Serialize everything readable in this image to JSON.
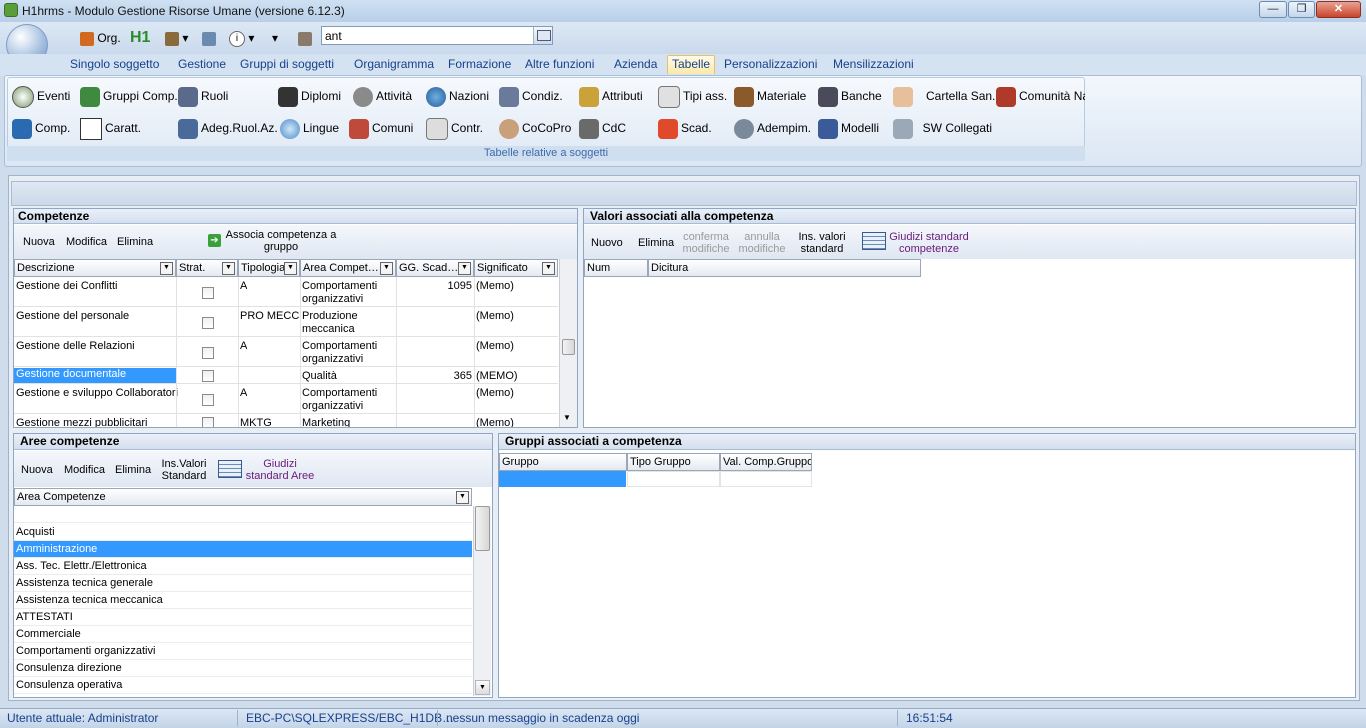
{
  "window": {
    "title": "H1hrms - Modulo Gestione Risorse Umane (versione 6.12.3)"
  },
  "qat": {
    "org_label": "Org.",
    "h1_label": "H1",
    "search_value": "ant"
  },
  "menu_tabs": [
    "Singolo soggetto",
    "Gestione",
    "Gruppi di soggetti",
    "Organigramma",
    "Formazione",
    "Altre funzioni",
    "Azienda",
    "Tabelle",
    "Personalizzazioni",
    "Mensilizzazioni"
  ],
  "ribbon": {
    "row1": [
      "Eventi",
      "Gruppi Comp.",
      "Ruoli",
      "Diplomi",
      "Attività",
      "Nazioni",
      "Condiz.",
      "Attributi",
      "Tipi ass.",
      "Materiale",
      "Banche",
      "Cartella San.",
      "Comunità Na"
    ],
    "row2": [
      "Comp.",
      "Caratt.",
      "Adeg.Ruol.Az.",
      "Lingue",
      "Comuni",
      "Contr.",
      "CoCoPro",
      "CdC",
      "Scad.",
      "Adempim.",
      "Modelli",
      "SW Collegati"
    ],
    "group_label": "Tabelle relative a soggetti"
  },
  "competenze": {
    "title": "Competenze",
    "toolbar": {
      "nuova": "Nuova",
      "modifica": "Modifica",
      "elimina": "Elimina",
      "associa_1": "Associa competenza a",
      "associa_2": "gruppo"
    },
    "columns": [
      "Descrizione",
      "Strat.",
      "Tipologia",
      "Area Compet…",
      "GG. Scad…",
      "Significato"
    ],
    "rows": [
      {
        "desc": "Gestione dei Conflitti",
        "tip": "A",
        "area1": "Comportamenti",
        "area2": "organizzativi",
        "gg": "1095",
        "sig": "(Memo)"
      },
      {
        "desc": "Gestione del personale",
        "tip": "PRO MECC",
        "area1": "Produzione",
        "area2": "meccanica",
        "gg": "",
        "sig": "(Memo)"
      },
      {
        "desc": "Gestione delle Relazioni",
        "tip": "A",
        "area1": "Comportamenti",
        "area2": "organizzativi",
        "gg": "",
        "sig": "(Memo)"
      },
      {
        "desc": "Gestione documentale",
        "tip": "",
        "area1": "Qualità",
        "area2": "",
        "gg": "365",
        "sig": "(MEMO)"
      },
      {
        "desc": "Gestione e sviluppo Collaboratori",
        "tip": "A",
        "area1": "Comportamenti",
        "area2": "organizzativi",
        "gg": "",
        "sig": "(Memo)"
      },
      {
        "desc": "Gestione mezzi pubblicitari",
        "tip": "MKTG",
        "area1": "Marketing",
        "area2": "",
        "gg": "",
        "sig": "(Memo)"
      }
    ]
  },
  "valori": {
    "title": "Valori associati alla competenza",
    "toolbar": {
      "nuovo": "Nuovo",
      "elimina": "Elimina",
      "conferma_1": "conferma",
      "conferma_2": "modifiche",
      "annulla_1": "annulla",
      "annulla_2": "modifiche",
      "ins_1": "Ins. valori",
      "ins_2": "standard",
      "giudizi_1": "Giudizi standard",
      "giudizi_2": "competenze"
    },
    "columns": [
      "Num",
      "Dicitura"
    ]
  },
  "aree": {
    "title": "Aree competenze",
    "toolbar": {
      "nuova": "Nuova",
      "modifica": "Modifica",
      "elimina": "Elimina",
      "ins_1": "Ins.Valori",
      "ins_2": "Standard",
      "giudizi_1": "Giudizi",
      "giudizi_2": "standard Aree"
    },
    "column": "Area Competenze",
    "items": [
      "",
      "Acquisti",
      "Amministrazione",
      "Ass. Tec. Elettr./Elettronica",
      "Assistenza tecnica generale",
      "Assistenza tecnica meccanica",
      "ATTESTATI",
      "Commerciale",
      "Comportamenti organizzativi",
      "Consulenza direzione",
      "Consulenza operativa"
    ]
  },
  "gruppi": {
    "title": "Gruppi associati a competenza",
    "columns": [
      "Gruppo",
      "Tipo Gruppo",
      "Val. Comp.Gruppo"
    ]
  },
  "status": {
    "user": "Utente attuale: Administrator",
    "db": "EBC-PC\\SQLEXPRESS/EBC_H1DB…",
    "messages": "nessun messaggio in scadenza oggi",
    "time": "16:51:54"
  }
}
